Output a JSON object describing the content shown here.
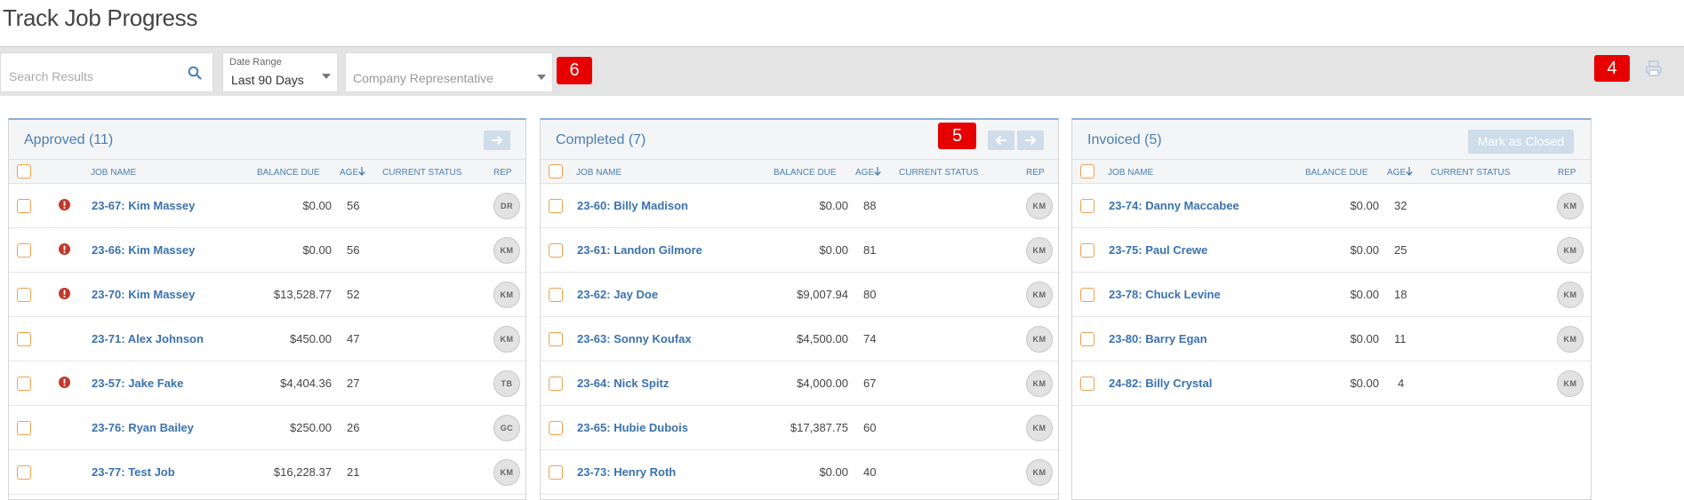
{
  "page": {
    "title": "Track Job Progress"
  },
  "toolbar": {
    "search_placeholder": "Search Results",
    "date_range_label": "Date Range",
    "date_range_value": "Last 90 Days",
    "rep_placeholder": "Company Representative",
    "badge_6": "6",
    "badge_4": "4",
    "badge_5": "5"
  },
  "columns": {
    "job_name": "JOB NAME",
    "balance_due": "BALANCE DUE",
    "age": "AGE",
    "current_status": "CURRENT STATUS",
    "rep": "REP"
  },
  "approved": {
    "title": "Approved (11)",
    "rows": [
      {
        "job": "23-67: Kim Massey",
        "balance": "$0.00",
        "age": "56",
        "rep": "DR",
        "alert": true
      },
      {
        "job": "23-66: Kim Massey",
        "balance": "$0.00",
        "age": "56",
        "rep": "KM",
        "alert": true
      },
      {
        "job": "23-70: Kim Massey",
        "balance": "$13,528.77",
        "age": "52",
        "rep": "KM",
        "alert": true
      },
      {
        "job": "23-71: Alex Johnson",
        "balance": "$450.00",
        "age": "47",
        "rep": "KM",
        "alert": false
      },
      {
        "job": "23-57: Jake Fake",
        "balance": "$4,404.36",
        "age": "27",
        "rep": "TB",
        "alert": true
      },
      {
        "job": "23-76: Ryan Bailey",
        "balance": "$250.00",
        "age": "26",
        "rep": "GC",
        "alert": false
      },
      {
        "job": "23-77: Test Job",
        "balance": "$16,228.37",
        "age": "21",
        "rep": "KM",
        "alert": false
      }
    ]
  },
  "completed": {
    "title": "Completed (7)",
    "rows": [
      {
        "job": "23-60: Billy Madison",
        "balance": "$0.00",
        "age": "88",
        "rep": "KM"
      },
      {
        "job": "23-61: Landon Gilmore",
        "balance": "$0.00",
        "age": "81",
        "rep": "KM"
      },
      {
        "job": "23-62: Jay Doe",
        "balance": "$9,007.94",
        "age": "80",
        "rep": "KM"
      },
      {
        "job": "23-63: Sonny Koufax",
        "balance": "$4,500.00",
        "age": "74",
        "rep": "KM"
      },
      {
        "job": "23-64: Nick Spitz",
        "balance": "$4,000.00",
        "age": "67",
        "rep": "KM"
      },
      {
        "job": "23-65: Hubie Dubois",
        "balance": "$17,387.75",
        "age": "60",
        "rep": "KM"
      },
      {
        "job": "23-73: Henry Roth",
        "balance": "$0.00",
        "age": "40",
        "rep": "KM"
      }
    ]
  },
  "invoiced": {
    "title": "Invoiced (5)",
    "mark_closed_label": "Mark as Closed",
    "rows": [
      {
        "job": "23-74: Danny Maccabee",
        "balance": "$0.00",
        "age": "32",
        "rep": "KM"
      },
      {
        "job": "23-75: Paul Crewe",
        "balance": "$0.00",
        "age": "25",
        "rep": "KM"
      },
      {
        "job": "23-78: Chuck Levine",
        "balance": "$0.00",
        "age": "18",
        "rep": "KM"
      },
      {
        "job": "23-80: Barry Egan",
        "balance": "$0.00",
        "age": "11",
        "rep": "KM"
      },
      {
        "job": "24-82: Billy Crystal",
        "balance": "$0.00",
        "age": "4",
        "rep": "KM"
      }
    ]
  },
  "colors": {
    "accent": "#4a7fb5",
    "checkbox": "#f0a050",
    "alert": "#c0392b",
    "badge": "#e60000"
  }
}
